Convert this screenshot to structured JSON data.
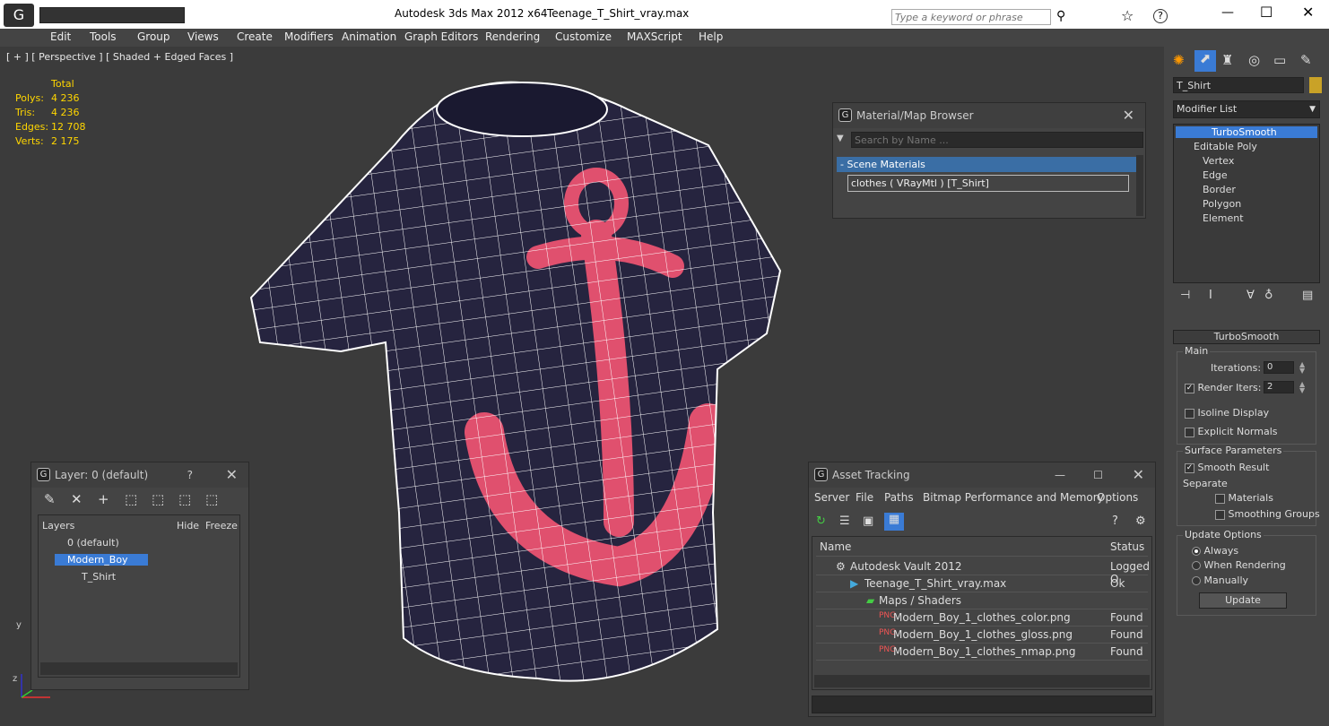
{
  "titlebar": {
    "app": "Autodesk 3ds Max  2012 x64",
    "file": "Teenage_T_Shirt_vray.max",
    "search_placeholder": "Type a keyword or phrase",
    "help": "?"
  },
  "menu": [
    "Edit",
    "Tools",
    "Group",
    "Views",
    "Create",
    "Modifiers",
    "Animation",
    "Graph Editors",
    "Rendering",
    "Customize",
    "MAXScript",
    "Help"
  ],
  "viewport": {
    "label": "[ + ] [ Perspective ] [ Shaded + Edged Faces ]",
    "stats": {
      "header": "Total",
      "rows": [
        {
          "k": "Polys:",
          "v": "4 236"
        },
        {
          "k": "Tris:",
          "v": "4 236"
        },
        {
          "k": "Edges:",
          "v": "12 708"
        },
        {
          "k": "Verts:",
          "v": "2 175"
        }
      ]
    },
    "axes": {
      "x": "x",
      "y": "y",
      "z": "z"
    }
  },
  "material_browser": {
    "title": "Material/Map Browser",
    "search_placeholder": "Search by Name ...",
    "section": "- Scene Materials",
    "item": "clothes  ( VRayMtl )  [T_Shirt]",
    "close": "✕"
  },
  "layer_window": {
    "title": "Layer: 0 (default)",
    "help": "?",
    "close": "✕",
    "headers": [
      "Layers",
      "Hide",
      "Freeze"
    ],
    "rows": [
      "0 (default)",
      "Modern_Boy",
      "T_Shirt"
    ]
  },
  "asset_tracking": {
    "title": "Asset Tracking",
    "menu": [
      "Server",
      "File",
      "Paths",
      "Bitmap Performance and Memory",
      "Options"
    ],
    "headers": [
      "Name",
      "Status"
    ],
    "rows": [
      {
        "name": "Autodesk Vault 2012",
        "status": "Logged O"
      },
      {
        "name": "Teenage_T_Shirt_vray.max",
        "status": "Ok"
      },
      {
        "name": "Maps / Shaders",
        "status": ""
      },
      {
        "name": "Modern_Boy_1_clothes_color.png",
        "status": "Found"
      },
      {
        "name": "Modern_Boy_1_clothes_gloss.png",
        "status": "Found"
      },
      {
        "name": "Modern_Boy_1_clothes_nmap.png",
        "status": "Found"
      }
    ],
    "min": "—",
    "max": "☐",
    "close": "✕"
  },
  "command_panel": {
    "object_name": "T_Shirt",
    "modifier_list": "Modifier List",
    "stack": [
      "TurboSmooth",
      "Editable Poly",
      "Vertex",
      "Edge",
      "Border",
      "Polygon",
      "Element"
    ],
    "rollout": "TurboSmooth",
    "main": "Main",
    "iterations_label": "Iterations:",
    "iterations": "0",
    "render_iters_label": "Render Iters:",
    "render_iters": "2",
    "isoline": "Isoline Display",
    "explicit_normals": "Explicit Normals",
    "surface_params": "Surface Parameters",
    "smooth_result": "Smooth Result",
    "separate": "Separate",
    "materials": "Materials",
    "smoothing_groups": "Smoothing Groups",
    "update_options": "Update Options",
    "always": "Always",
    "when_rendering": "When Rendering",
    "manually": "Manually",
    "update_button": "Update"
  },
  "colors": {
    "shirt": "#26243f",
    "anchor": "#e0506e",
    "accent": "#3a7bd5",
    "object_color": "#c9a227"
  }
}
